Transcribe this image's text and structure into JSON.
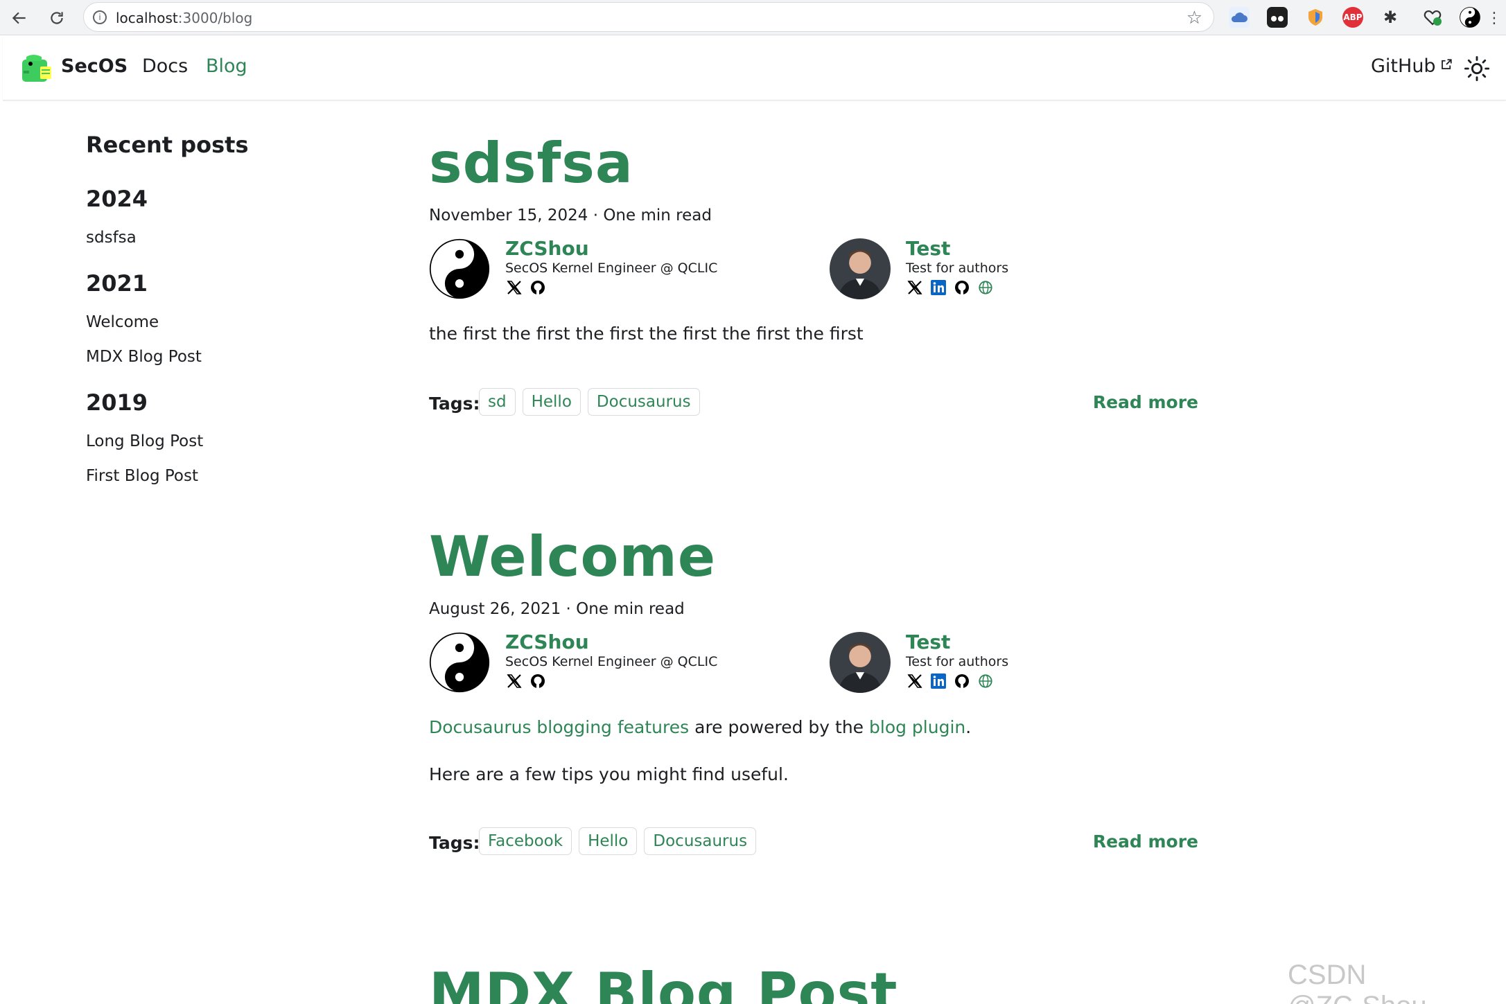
{
  "browser": {
    "url_host": "localhost",
    "url_path": ":3000/blog"
  },
  "navbar": {
    "brand": "SecOS",
    "links": [
      "Docs",
      "Blog"
    ],
    "github": "GitHub"
  },
  "sidebar": {
    "title": "Recent posts",
    "groups": [
      {
        "year": "2024",
        "posts": [
          "sdsfsa"
        ]
      },
      {
        "year": "2021",
        "posts": [
          "Welcome",
          "MDX Blog Post"
        ]
      },
      {
        "year": "2019",
        "posts": [
          "Long Blog Post",
          "First Blog Post"
        ]
      }
    ]
  },
  "posts": [
    {
      "title": "sdsfsa",
      "meta": "November 15, 2024 · One min read",
      "authors": [
        {
          "name": "ZCShou",
          "title": "SecOS Kernel Engineer @ QCLIC"
        },
        {
          "name": "Test",
          "title": "Test for authors"
        }
      ],
      "body": "the first the first the first the first the first the first",
      "tags_label": "Tags:",
      "tags": [
        "sd",
        "Hello",
        "Docusaurus"
      ],
      "read_more": "Read more"
    },
    {
      "title": "Welcome",
      "meta": "August 26, 2021 · One min read",
      "authors": [
        {
          "name": "ZCShou",
          "title": "SecOS Kernel Engineer @ QCLIC"
        },
        {
          "name": "Test",
          "title": "Test for authors"
        }
      ],
      "body_link1": "Docusaurus blogging features",
      "body_mid": " are powered by the ",
      "body_link2": "blog plugin",
      "body_end": ".",
      "body2": "Here are a few tips you might find useful.",
      "tags_label": "Tags:",
      "tags": [
        "Facebook",
        "Hello",
        "Docusaurus"
      ],
      "read_more": "Read more"
    },
    {
      "title": "MDX Blog Post"
    }
  ],
  "watermark": "CSDN @ZC·Shou",
  "colors": {
    "accent": "#2e8555",
    "text": "#1c1e21"
  }
}
